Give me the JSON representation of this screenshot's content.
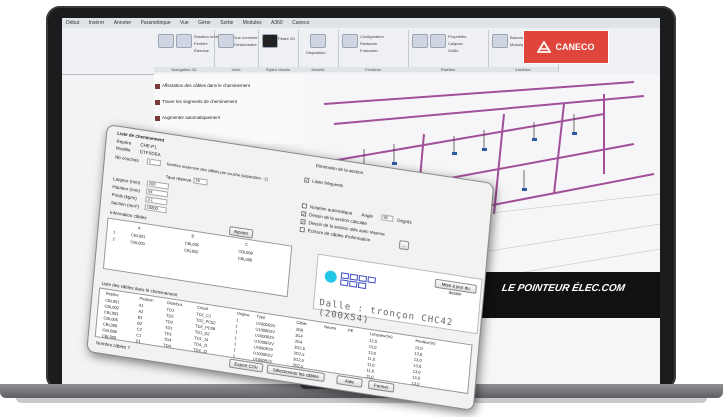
{
  "ribbon": {
    "tabs": [
      "Début",
      "Insérer",
      "Annoter",
      "Paramétrique",
      "Vue",
      "Gérer",
      "Sortie",
      "Modules",
      "A360",
      "Caneco"
    ],
    "groups": [
      {
        "title": "Navigation 2D",
        "labels": [
          "Rotation orbit",
          "Fenêtre",
          "Étendue"
        ]
      },
      {
        "title": "Vues",
        "labels": [
          "Vue nommée",
          "Gestionnaire"
        ]
      },
      {
        "title": "Styles visuels",
        "labels": [
          "Filaire 2D"
        ]
      },
      {
        "title": "Modèle",
        "labels": [
          "Disposition"
        ]
      },
      {
        "title": "Fenêtres",
        "labels": [
          "Configuration",
          "Restaurer",
          "Fusionner"
        ]
      },
      {
        "title": "Palettes",
        "labels": [
          "Propriétés",
          "Calques",
          "Outils"
        ]
      },
      {
        "title": "Interface",
        "labels": [
          "Basculer les fenêtres",
          "Mosaïque"
        ]
      }
    ]
  },
  "badge": {
    "brand": "CANECO"
  },
  "left_panel": {
    "items": [
      "Affectation des câbles dans le cheminement",
      "Tracer les segments de cheminement",
      "Augmenter automatiquement"
    ]
  },
  "canvas_caption": "LE POINTEUR ÉLEC.COM",
  "dialog": {
    "heading": "Liste de cheminement",
    "tag_fields": [
      {
        "label": "Repère",
        "value": "CHE-P1"
      },
      {
        "label": "Modèle",
        "value": "DTFXDEA"
      }
    ],
    "nb_label": "Nb couches",
    "nb_value": "1",
    "hint": "Nombre maximum des câbles par couche (séparation : 2)",
    "reserve_label": "Taux réserve",
    "reserve_value": "25",
    "dims": [
      {
        "label": "Largeur (mm)",
        "value": "200"
      },
      {
        "label": "Hauteur (mm)",
        "value": "54"
      },
      {
        "label": "Poids (kg/m)",
        "value": "3.1"
      },
      {
        "label": "Section (mm²)",
        "value": "10800"
      }
    ],
    "dimension_section": "Dimension de la section",
    "options": [
      "Lister fréquents",
      "Notation automatique",
      "Dessin de la section calculée",
      "Dessin de la section utile avec réserve",
      "Écriture de câbles d'information"
    ],
    "angle_label": "Angle",
    "angle_value": "90",
    "degree_label": "Degrés",
    "refresh_btn": "...",
    "info_label": "Information câbles",
    "upper_table": {
      "headers": [
        "",
        "A",
        "B",
        "C"
      ],
      "rows": [
        [
          "1",
          "CBL001",
          "CBL005",
          "CBL008"
        ],
        [
          "2",
          "CBL003",
          "CBL002",
          "CBL006"
        ]
      ]
    },
    "add_btn": "Ajouter",
    "print_btn": "Mise à jour du dessin",
    "dalle_text": "Dalle : tronçon CHC42 (200X54)",
    "list_title": "Liste des câbles dans le cheminement",
    "list_headers": [
      "Repère",
      "Position",
      "Distribut.",
      "Circuit",
      "Origine",
      "Type",
      "Câble",
      "Neutre",
      "PE",
      "Longueur(m)",
      "Hauteur(m)"
    ],
    "list_rows": [
      [
        "CBL001",
        "A1",
        "TD1",
        "TD1_C1",
        "1",
        "U1000R2V",
        "3G6",
        "",
        "",
        "12,0",
        "13,0"
      ],
      [
        "CBL002",
        "A2",
        "TD2",
        "TD2_PC02",
        "1",
        "U1000R2V",
        "3G4",
        "",
        "",
        "13,0",
        "13,0"
      ],
      [
        "CBL003",
        "B1",
        "TD2",
        "TD2_PC08",
        "1",
        "U1000R2V",
        "3G4",
        "",
        "",
        "13,0",
        "13,0"
      ],
      [
        "CBL005",
        "B2",
        "TD1",
        "TD1_D2",
        "1",
        "U1000R2V",
        "3G2,5",
        "",
        "",
        "11,0",
        "13,0"
      ],
      [
        "CBL006",
        "C2",
        "TD1",
        "TD1_J4",
        "1",
        "U1000R2V",
        "3G2,5",
        "",
        "",
        "11,0",
        "13,0"
      ],
      [
        "CBL008",
        "C1",
        "TD4",
        "TD4_J1",
        "1",
        "U1000R2V",
        "3G2,5",
        "",
        "",
        "11,0",
        "13,0"
      ],
      [
        "CBL009",
        "D1",
        "TD4",
        "TD4_J2",
        "1",
        "U1000R2V",
        "3G2,5",
        "",
        "",
        "11,0",
        "13,0"
      ]
    ],
    "footer_left": "Nombre câbles 7",
    "buttons": [
      "Export CSV",
      "Sélectionner les câbles",
      "Aide",
      "Fermer"
    ]
  }
}
